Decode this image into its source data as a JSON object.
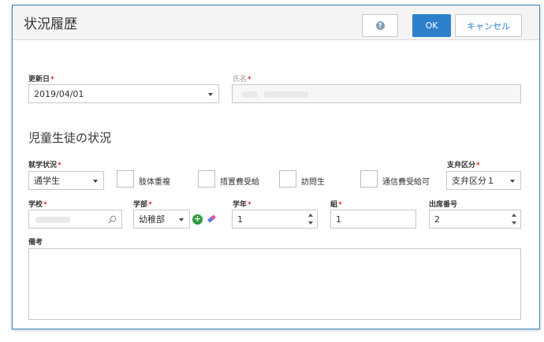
{
  "dialog": {
    "title": "状況履歴",
    "ok_label": "OK",
    "cancel_label": "キャンセル",
    "help_glyph": "?"
  },
  "required_mark": "*",
  "update_date": {
    "label": "更新日",
    "value": "2019/04/01"
  },
  "name": {
    "label": "氏名",
    "value": ""
  },
  "section": {
    "title": "児童生徒の状況"
  },
  "enrollment_status": {
    "label": "就学状況",
    "value": "通学生"
  },
  "checkboxes": [
    {
      "label": "肢体重複",
      "checked": false
    },
    {
      "label": "措置費受給",
      "checked": false
    },
    {
      "label": "訪問生",
      "checked": false
    },
    {
      "label": "通信費受給可",
      "checked": false
    }
  ],
  "support_category": {
    "label": "支弁区分",
    "value": "支弁区分１"
  },
  "school": {
    "label": "学校",
    "value": ""
  },
  "department": {
    "label": "学部",
    "value": "幼稚部"
  },
  "grade": {
    "label": "学年",
    "value": "1"
  },
  "class_group": {
    "label": "組",
    "value": "1"
  },
  "attendance_number": {
    "label": "出席番号",
    "value": "2"
  },
  "remarks": {
    "label": "備考",
    "value": ""
  },
  "colors": {
    "accent": "#2d80cc",
    "required": "#d9302a",
    "add": "#2b9d3c"
  }
}
